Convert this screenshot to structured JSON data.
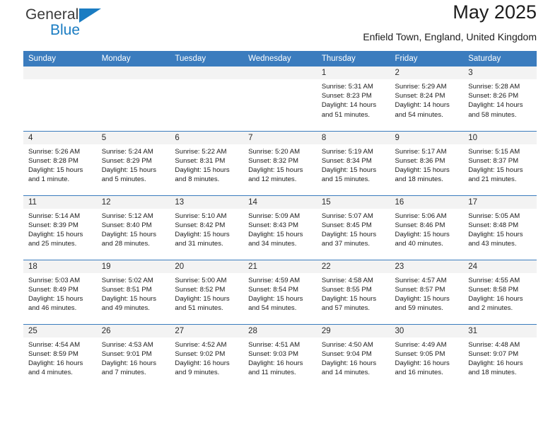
{
  "brand": {
    "name_line1": "General",
    "name_line2": "Blue",
    "triangle_color": "#1a7cc2"
  },
  "header": {
    "title": "May 2025",
    "subtitle": "Enfield Town, England, United Kingdom",
    "header_bg_color": "#3b7cbe",
    "header_text_color": "#ffffff",
    "daynum_bg_color": "#f3f3f3"
  },
  "weekday_headers": [
    "Sunday",
    "Monday",
    "Tuesday",
    "Wednesday",
    "Thursday",
    "Friday",
    "Saturday"
  ],
  "labels": {
    "sunrise_prefix": "Sunrise:",
    "sunset_prefix": "Sunset:",
    "daylight_prefix": "Daylight:"
  },
  "weeks": [
    [
      {
        "day": "",
        "empty": true,
        "sunrise": "",
        "sunset": "",
        "daylight_line1": "",
        "daylight_line2": ""
      },
      {
        "day": "",
        "empty": true,
        "sunrise": "",
        "sunset": "",
        "daylight_line1": "",
        "daylight_line2": ""
      },
      {
        "day": "",
        "empty": true,
        "sunrise": "",
        "sunset": "",
        "daylight_line1": "",
        "daylight_line2": ""
      },
      {
        "day": "",
        "empty": true,
        "sunrise": "",
        "sunset": "",
        "daylight_line1": "",
        "daylight_line2": ""
      },
      {
        "day": "1",
        "empty": false,
        "sunrise": "Sunrise: 5:31 AM",
        "sunset": "Sunset: 8:23 PM",
        "daylight_line1": "Daylight: 14 hours",
        "daylight_line2": "and 51 minutes."
      },
      {
        "day": "2",
        "empty": false,
        "sunrise": "Sunrise: 5:29 AM",
        "sunset": "Sunset: 8:24 PM",
        "daylight_line1": "Daylight: 14 hours",
        "daylight_line2": "and 54 minutes."
      },
      {
        "day": "3",
        "empty": false,
        "sunrise": "Sunrise: 5:28 AM",
        "sunset": "Sunset: 8:26 PM",
        "daylight_line1": "Daylight: 14 hours",
        "daylight_line2": "and 58 minutes."
      }
    ],
    [
      {
        "day": "4",
        "empty": false,
        "sunrise": "Sunrise: 5:26 AM",
        "sunset": "Sunset: 8:28 PM",
        "daylight_line1": "Daylight: 15 hours",
        "daylight_line2": "and 1 minute."
      },
      {
        "day": "5",
        "empty": false,
        "sunrise": "Sunrise: 5:24 AM",
        "sunset": "Sunset: 8:29 PM",
        "daylight_line1": "Daylight: 15 hours",
        "daylight_line2": "and 5 minutes."
      },
      {
        "day": "6",
        "empty": false,
        "sunrise": "Sunrise: 5:22 AM",
        "sunset": "Sunset: 8:31 PM",
        "daylight_line1": "Daylight: 15 hours",
        "daylight_line2": "and 8 minutes."
      },
      {
        "day": "7",
        "empty": false,
        "sunrise": "Sunrise: 5:20 AM",
        "sunset": "Sunset: 8:32 PM",
        "daylight_line1": "Daylight: 15 hours",
        "daylight_line2": "and 12 minutes."
      },
      {
        "day": "8",
        "empty": false,
        "sunrise": "Sunrise: 5:19 AM",
        "sunset": "Sunset: 8:34 PM",
        "daylight_line1": "Daylight: 15 hours",
        "daylight_line2": "and 15 minutes."
      },
      {
        "day": "9",
        "empty": false,
        "sunrise": "Sunrise: 5:17 AM",
        "sunset": "Sunset: 8:36 PM",
        "daylight_line1": "Daylight: 15 hours",
        "daylight_line2": "and 18 minutes."
      },
      {
        "day": "10",
        "empty": false,
        "sunrise": "Sunrise: 5:15 AM",
        "sunset": "Sunset: 8:37 PM",
        "daylight_line1": "Daylight: 15 hours",
        "daylight_line2": "and 21 minutes."
      }
    ],
    [
      {
        "day": "11",
        "empty": false,
        "sunrise": "Sunrise: 5:14 AM",
        "sunset": "Sunset: 8:39 PM",
        "daylight_line1": "Daylight: 15 hours",
        "daylight_line2": "and 25 minutes."
      },
      {
        "day": "12",
        "empty": false,
        "sunrise": "Sunrise: 5:12 AM",
        "sunset": "Sunset: 8:40 PM",
        "daylight_line1": "Daylight: 15 hours",
        "daylight_line2": "and 28 minutes."
      },
      {
        "day": "13",
        "empty": false,
        "sunrise": "Sunrise: 5:10 AM",
        "sunset": "Sunset: 8:42 PM",
        "daylight_line1": "Daylight: 15 hours",
        "daylight_line2": "and 31 minutes."
      },
      {
        "day": "14",
        "empty": false,
        "sunrise": "Sunrise: 5:09 AM",
        "sunset": "Sunset: 8:43 PM",
        "daylight_line1": "Daylight: 15 hours",
        "daylight_line2": "and 34 minutes."
      },
      {
        "day": "15",
        "empty": false,
        "sunrise": "Sunrise: 5:07 AM",
        "sunset": "Sunset: 8:45 PM",
        "daylight_line1": "Daylight: 15 hours",
        "daylight_line2": "and 37 minutes."
      },
      {
        "day": "16",
        "empty": false,
        "sunrise": "Sunrise: 5:06 AM",
        "sunset": "Sunset: 8:46 PM",
        "daylight_line1": "Daylight: 15 hours",
        "daylight_line2": "and 40 minutes."
      },
      {
        "day": "17",
        "empty": false,
        "sunrise": "Sunrise: 5:05 AM",
        "sunset": "Sunset: 8:48 PM",
        "daylight_line1": "Daylight: 15 hours",
        "daylight_line2": "and 43 minutes."
      }
    ],
    [
      {
        "day": "18",
        "empty": false,
        "sunrise": "Sunrise: 5:03 AM",
        "sunset": "Sunset: 8:49 PM",
        "daylight_line1": "Daylight: 15 hours",
        "daylight_line2": "and 46 minutes."
      },
      {
        "day": "19",
        "empty": false,
        "sunrise": "Sunrise: 5:02 AM",
        "sunset": "Sunset: 8:51 PM",
        "daylight_line1": "Daylight: 15 hours",
        "daylight_line2": "and 49 minutes."
      },
      {
        "day": "20",
        "empty": false,
        "sunrise": "Sunrise: 5:00 AM",
        "sunset": "Sunset: 8:52 PM",
        "daylight_line1": "Daylight: 15 hours",
        "daylight_line2": "and 51 minutes."
      },
      {
        "day": "21",
        "empty": false,
        "sunrise": "Sunrise: 4:59 AM",
        "sunset": "Sunset: 8:54 PM",
        "daylight_line1": "Daylight: 15 hours",
        "daylight_line2": "and 54 minutes."
      },
      {
        "day": "22",
        "empty": false,
        "sunrise": "Sunrise: 4:58 AM",
        "sunset": "Sunset: 8:55 PM",
        "daylight_line1": "Daylight: 15 hours",
        "daylight_line2": "and 57 minutes."
      },
      {
        "day": "23",
        "empty": false,
        "sunrise": "Sunrise: 4:57 AM",
        "sunset": "Sunset: 8:57 PM",
        "daylight_line1": "Daylight: 15 hours",
        "daylight_line2": "and 59 minutes."
      },
      {
        "day": "24",
        "empty": false,
        "sunrise": "Sunrise: 4:55 AM",
        "sunset": "Sunset: 8:58 PM",
        "daylight_line1": "Daylight: 16 hours",
        "daylight_line2": "and 2 minutes."
      }
    ],
    [
      {
        "day": "25",
        "empty": false,
        "sunrise": "Sunrise: 4:54 AM",
        "sunset": "Sunset: 8:59 PM",
        "daylight_line1": "Daylight: 16 hours",
        "daylight_line2": "and 4 minutes."
      },
      {
        "day": "26",
        "empty": false,
        "sunrise": "Sunrise: 4:53 AM",
        "sunset": "Sunset: 9:01 PM",
        "daylight_line1": "Daylight: 16 hours",
        "daylight_line2": "and 7 minutes."
      },
      {
        "day": "27",
        "empty": false,
        "sunrise": "Sunrise: 4:52 AM",
        "sunset": "Sunset: 9:02 PM",
        "daylight_line1": "Daylight: 16 hours",
        "daylight_line2": "and 9 minutes."
      },
      {
        "day": "28",
        "empty": false,
        "sunrise": "Sunrise: 4:51 AM",
        "sunset": "Sunset: 9:03 PM",
        "daylight_line1": "Daylight: 16 hours",
        "daylight_line2": "and 11 minutes."
      },
      {
        "day": "29",
        "empty": false,
        "sunrise": "Sunrise: 4:50 AM",
        "sunset": "Sunset: 9:04 PM",
        "daylight_line1": "Daylight: 16 hours",
        "daylight_line2": "and 14 minutes."
      },
      {
        "day": "30",
        "empty": false,
        "sunrise": "Sunrise: 4:49 AM",
        "sunset": "Sunset: 9:05 PM",
        "daylight_line1": "Daylight: 16 hours",
        "daylight_line2": "and 16 minutes."
      },
      {
        "day": "31",
        "empty": false,
        "sunrise": "Sunrise: 4:48 AM",
        "sunset": "Sunset: 9:07 PM",
        "daylight_line1": "Daylight: 16 hours",
        "daylight_line2": "and 18 minutes."
      }
    ]
  ]
}
